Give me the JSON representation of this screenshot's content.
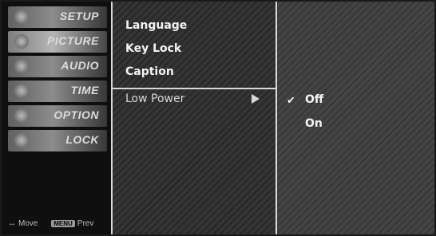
{
  "sidebar": {
    "items": [
      {
        "label": "SETUP"
      },
      {
        "label": "PICTURE"
      },
      {
        "label": "AUDIO"
      },
      {
        "label": "TIME"
      },
      {
        "label": "OPTION"
      },
      {
        "label": "LOCK"
      }
    ],
    "footer": {
      "move_icon": "↔",
      "move_label": "Move",
      "menu_key": "MENU",
      "prev_label": "Prev"
    }
  },
  "menu": {
    "items": [
      "Language",
      "Key Lock",
      "Caption"
    ],
    "selected": "Low Power"
  },
  "submenu": {
    "check": "✔",
    "options": [
      "Off",
      "On"
    ],
    "selected_value": "Off"
  }
}
